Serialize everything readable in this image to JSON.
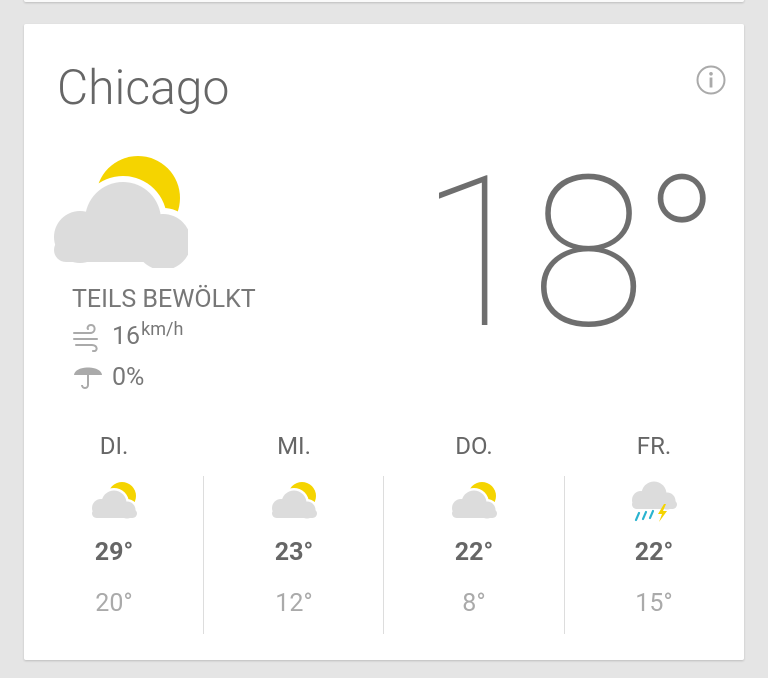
{
  "weather": {
    "city": "Chicago",
    "current_temp": "18°",
    "condition": "TEILS BEWÖLKT",
    "condition_icon": "partly-cloudy-icon",
    "wind_speed": "16",
    "wind_unit": "km/h",
    "precipitation": "0%"
  },
  "forecast": [
    {
      "day": "DI.",
      "high": "29°",
      "low": "20°",
      "icon": "partly-cloudy-icon"
    },
    {
      "day": "MI.",
      "high": "23°",
      "low": "12°",
      "icon": "partly-cloudy-icon"
    },
    {
      "day": "DO.",
      "high": "22°",
      "low": "8°",
      "icon": "partly-cloudy-icon"
    },
    {
      "day": "FR.",
      "high": "22°",
      "low": "15°",
      "icon": "thunderstorm-icon"
    }
  ],
  "colors": {
    "sun": "#f5d400",
    "cloud": "#dcdcdc",
    "rain": "#2ab3cf",
    "text_dark": "#666666",
    "text_light": "#aaaaaa"
  }
}
